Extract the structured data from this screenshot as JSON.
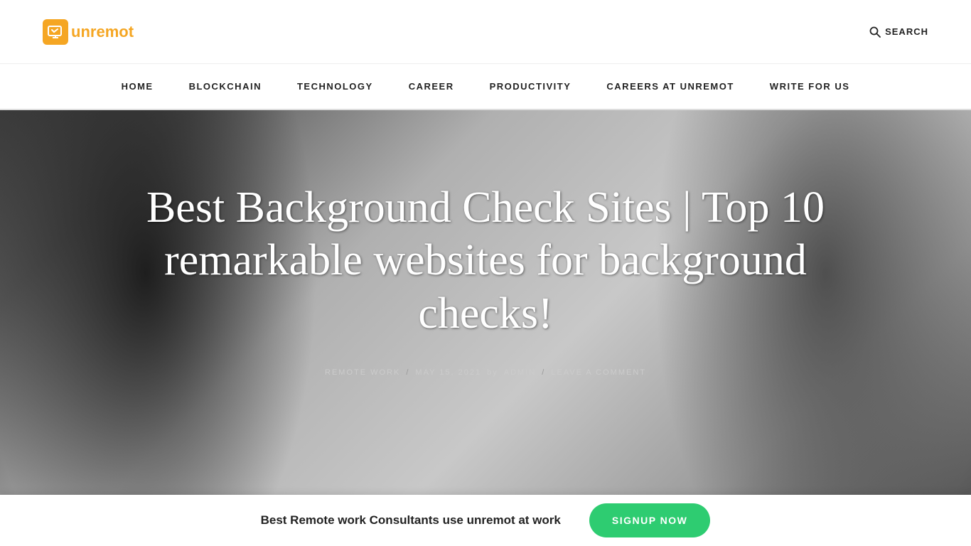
{
  "header": {
    "logo_icon": "🖥",
    "logo_text_un": "un",
    "logo_text_remot": "remot",
    "search_label": "SEARCH"
  },
  "nav": {
    "items": [
      {
        "label": "HOME",
        "id": "home"
      },
      {
        "label": "BLOCKCHAIN",
        "id": "blockchain"
      },
      {
        "label": "TECHNOLOGY",
        "id": "technology"
      },
      {
        "label": "CAREER",
        "id": "career"
      },
      {
        "label": "PRODUCTIVITY",
        "id": "productivity"
      },
      {
        "label": "CAREERS AT UNREMOT",
        "id": "careers-at-unremot"
      },
      {
        "label": "WRITE FOR US",
        "id": "write-for-us"
      }
    ]
  },
  "hero": {
    "title": "Best Background Check Sites | Top 10 remarkable websites for background checks!",
    "meta": {
      "category": "REMOTE WORK",
      "date": "MAY 15, 2021",
      "author_prefix": "by",
      "author": "ADMIN",
      "comment_link": "LEAVE A COMMENT"
    }
  },
  "cta_bar": {
    "text": "Best Remote work Consultants use unremot at work",
    "button_label": "SIGNUP NOW"
  }
}
